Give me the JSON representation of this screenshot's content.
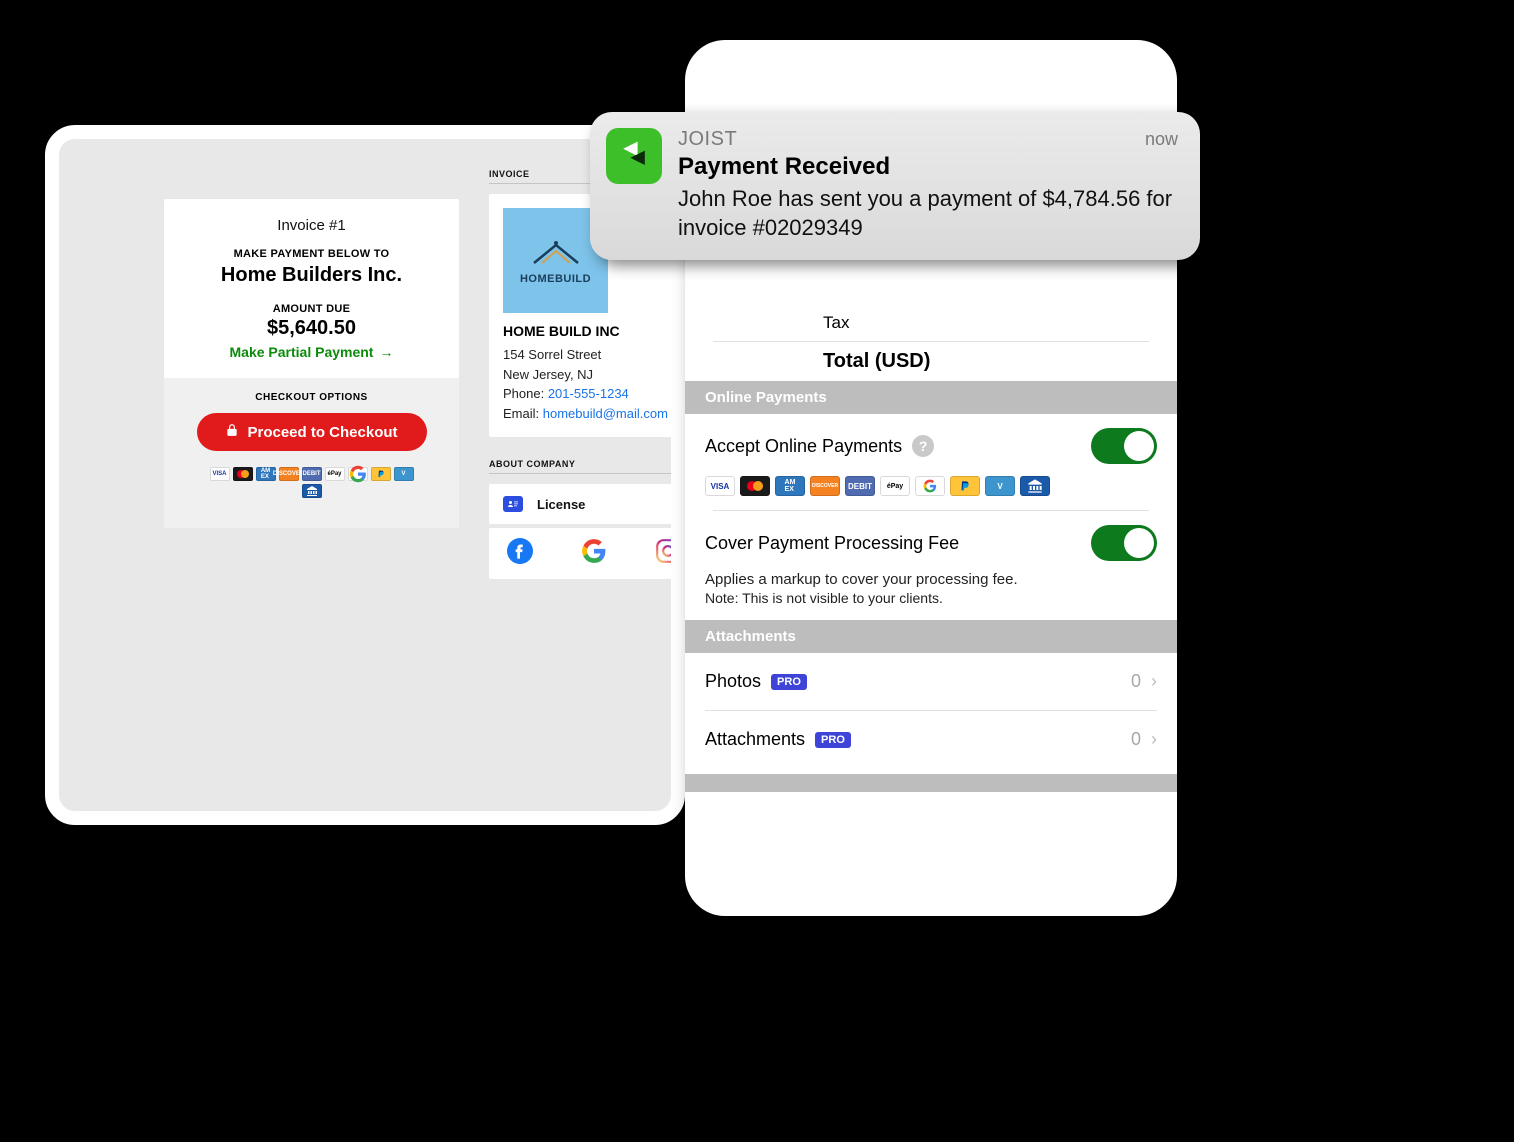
{
  "desktop": {
    "invoice_section_label": "INVOICE",
    "invoice_title": "Invoice #1",
    "make_payment_label": "MAKE PAYMENT BELOW TO",
    "company_name": "Home Builders Inc.",
    "amount_due_label": "AMOUNT DUE",
    "amount_due": "$5,640.50",
    "partial_link": "Make Partial Payment",
    "checkout_options_label": "CHECKOUT OPTIONS",
    "checkout_button": "Proceed to Checkout",
    "company": {
      "logo_text": "HOMEBUILD",
      "name": "HOME BUILD INC",
      "street": "154 Sorrel Street",
      "city": "New Jersey, NJ",
      "phone_label": "Phone:",
      "phone": "201-555-1234",
      "email_label": "Email:",
      "email": "homebuild@mail.com"
    },
    "about_label": "ABOUT COMPANY",
    "license_label": "License"
  },
  "phone": {
    "tax_label": "Tax",
    "total_label": "Total (USD)",
    "online_payments_header": "Online Payments",
    "accept_label": "Accept Online Payments",
    "cover_fee_label": "Cover Payment Processing Fee",
    "cover_fee_note1": "Applies a markup to cover your processing fee.",
    "cover_fee_note2": "Note: This is not visible to your clients.",
    "attachments_header": "Attachments",
    "photos_label": "Photos",
    "photos_count": "0",
    "attachments_label": "Attachments",
    "attachments_count": "0",
    "pro_badge": "PRO"
  },
  "notification": {
    "app": "JOIST",
    "time": "now",
    "title": "Payment Received",
    "message": "John Roe has sent you a payment of $4,784.56 for invoice #02029349"
  },
  "payment_badges": [
    "VISA",
    "MC",
    "AMEX",
    "DISCOVER",
    "DEBIT",
    "éPay",
    "G",
    "PP",
    "V",
    "BANK"
  ]
}
